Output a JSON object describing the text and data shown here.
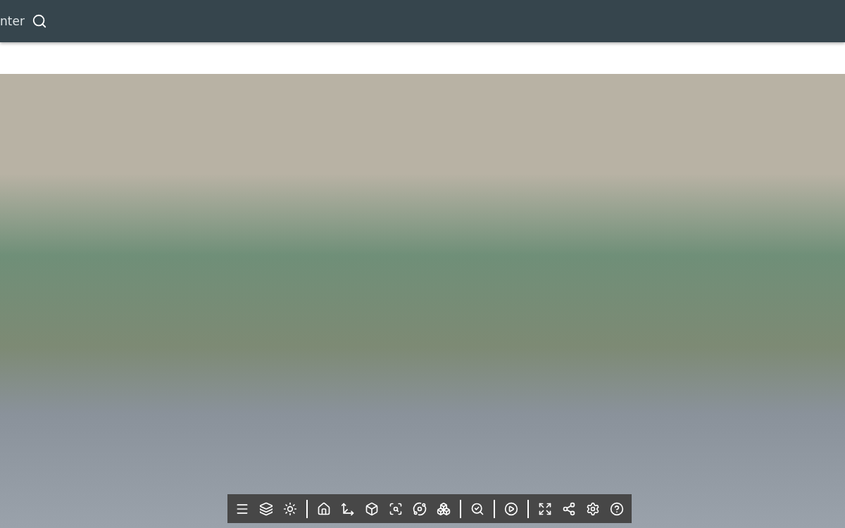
{
  "header": {
    "search_text": "nter"
  }
}
